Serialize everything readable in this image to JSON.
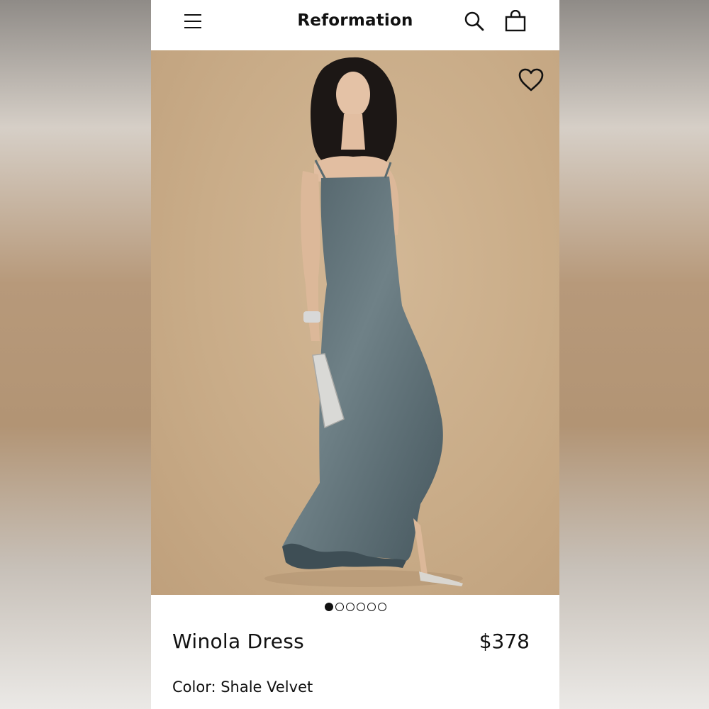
{
  "header": {
    "brand": "Reformation",
    "menu_icon": "hamburger-menu-icon",
    "search_icon": "search-icon",
    "bag_icon": "shopping-bag-icon"
  },
  "gallery": {
    "image_alt": "Model wearing velvet slip dress with ruffled hem",
    "wishlist_icon": "heart-outline-icon",
    "dot_count": 6,
    "active_index": 0
  },
  "product": {
    "name": "Winola Dress",
    "price": "$378",
    "color_label": "Color:",
    "color_value": "Shale Velvet",
    "color_text": "Color: Shale Velvet"
  },
  "colors": {
    "background_tan": "#c9ac88",
    "dress": "#5a6b70",
    "text": "#111111"
  }
}
